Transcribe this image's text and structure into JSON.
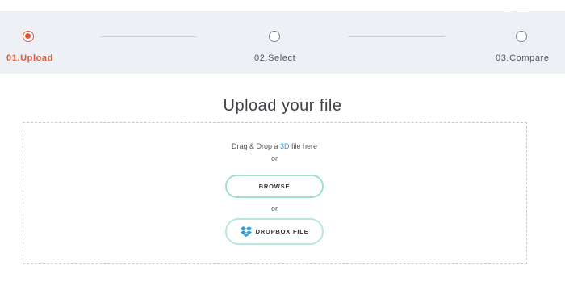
{
  "stepper": {
    "steps": [
      {
        "label": "01.Upload",
        "state": "active"
      },
      {
        "label": "02.Select",
        "state": "inactive"
      },
      {
        "label": "03.Compare",
        "state": "inactive"
      }
    ]
  },
  "main": {
    "title": "Upload your file",
    "dropzone": {
      "drag_prefix": "Drag & Drop a ",
      "drag_highlight": "3D",
      "drag_suffix": " file here",
      "or_1": "or",
      "browse_label": "BROWSE",
      "or_2": "or",
      "dropbox_label": "DROPBOX FILE"
    }
  },
  "colors": {
    "accent": "#e05a3a",
    "link": "#2a9fd8",
    "button_border": "#9ee3c6",
    "dropbox_blue": "#2a9fd8"
  },
  "icons": {
    "dropbox": "dropbox-icon"
  }
}
